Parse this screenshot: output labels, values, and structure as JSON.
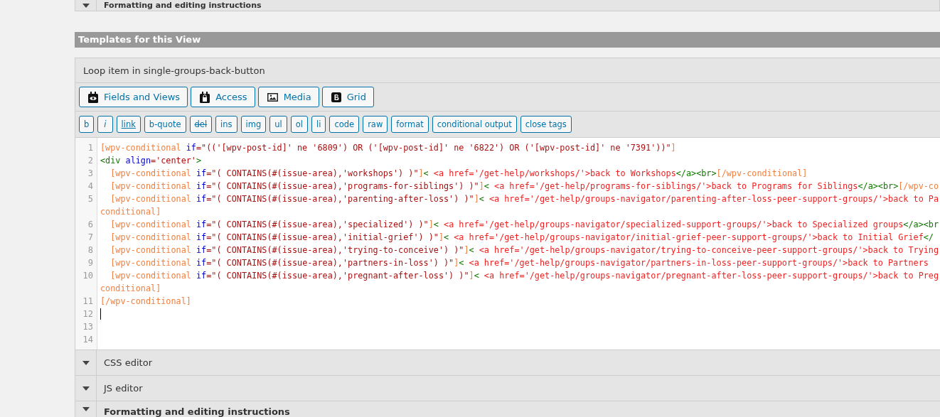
{
  "top_section": {
    "title": "Formatting and editing instructions"
  },
  "section_title": "Templates for this View",
  "template": {
    "title": "Loop item in single-groups-back-button",
    "toolbar": [
      {
        "label": "Fields and Views"
      },
      {
        "label": "Access"
      },
      {
        "label": "Media"
      },
      {
        "label": "Grid"
      }
    ],
    "quicktags": [
      {
        "label": "b",
        "kind": "plain"
      },
      {
        "label": "i",
        "kind": "italic"
      },
      {
        "label": "link",
        "kind": "underline"
      },
      {
        "label": "b-quote",
        "kind": "plain"
      },
      {
        "label": "del",
        "kind": "strike"
      },
      {
        "label": "ins",
        "kind": "plain"
      },
      {
        "label": "img",
        "kind": "plain"
      },
      {
        "label": "ul",
        "kind": "plain"
      },
      {
        "label": "ol",
        "kind": "plain"
      },
      {
        "label": "li",
        "kind": "plain"
      },
      {
        "label": "code",
        "kind": "plain"
      },
      {
        "label": "raw",
        "kind": "plain"
      },
      {
        "label": "format",
        "kind": "plain"
      },
      {
        "label": "conditional output",
        "kind": "plain"
      },
      {
        "label": "close tags",
        "kind": "plain"
      }
    ],
    "code_lines": [
      {
        "number": "1",
        "rows": [
          [
            {
              "kind": "shortcode",
              "text": "[wpv-conditional"
            },
            {
              "kind": "plain",
              "text": " "
            },
            {
              "kind": "keyword",
              "text": "if"
            },
            {
              "kind": "string",
              "text": "=\"(('[wpv-post-id]' ne '6809') OR ('[wpv-post-id]' ne '6822') OR ('[wpv-post-id]' ne '7391'))\""
            },
            {
              "kind": "shortcode",
              "text": "]"
            }
          ]
        ]
      },
      {
        "number": "2",
        "rows": [
          [
            {
              "kind": "tag",
              "text": "<div"
            },
            {
              "kind": "plain",
              "text": " "
            },
            {
              "kind": "keyword",
              "text": "align"
            },
            {
              "kind": "string",
              "text": "='center'"
            },
            {
              "kind": "tag",
              "text": ">"
            }
          ]
        ]
      },
      {
        "number": "3",
        "rows": [
          [
            {
              "kind": "plain",
              "text": "  "
            },
            {
              "kind": "shortcode",
              "text": "[wpv-conditional"
            },
            {
              "kind": "plain",
              "text": " "
            },
            {
              "kind": "keyword",
              "text": "if"
            },
            {
              "kind": "string",
              "text": "=\"( CONTAINS(#(issue-area),'workshops') )\""
            },
            {
              "kind": "shortcode",
              "text": "]"
            },
            {
              "kind": "tag",
              "text": "<"
            },
            {
              "kind": "error",
              "text": " <a href='/get-help/workshops/'>back to Workshops"
            },
            {
              "kind": "tag",
              "text": "</a><br>"
            },
            {
              "kind": "shortcode",
              "text": "[/wpv-conditional]"
            }
          ]
        ]
      },
      {
        "number": "4",
        "rows": [
          [
            {
              "kind": "plain",
              "text": "  "
            },
            {
              "kind": "shortcode",
              "text": "[wpv-conditional"
            },
            {
              "kind": "plain",
              "text": " "
            },
            {
              "kind": "keyword",
              "text": "if"
            },
            {
              "kind": "string",
              "text": "=\"( CONTAINS(#(issue-area),'programs-for-siblings') )\""
            },
            {
              "kind": "shortcode",
              "text": "]"
            },
            {
              "kind": "tag",
              "text": "<"
            },
            {
              "kind": "error",
              "text": " <a href='/get-help/programs-for-siblings/'>back to Programs for Siblings"
            },
            {
              "kind": "tag",
              "text": "</a><br>"
            },
            {
              "kind": "shortcode",
              "text": "[/wpv-co"
            }
          ]
        ]
      },
      {
        "number": "5",
        "rows": [
          [
            {
              "kind": "plain",
              "text": "  "
            },
            {
              "kind": "shortcode",
              "text": "[wpv-conditional"
            },
            {
              "kind": "plain",
              "text": " "
            },
            {
              "kind": "keyword",
              "text": "if"
            },
            {
              "kind": "string",
              "text": "=\"( CONTAINS(#(issue-area),'parenting-after-loss') )\""
            },
            {
              "kind": "shortcode",
              "text": "]"
            },
            {
              "kind": "tag",
              "text": "<"
            },
            {
              "kind": "error",
              "text": " <a href='/get-help/groups-navigator/parenting-after-loss-peer-support-groups/'>back to Pa"
            }
          ],
          [
            {
              "kind": "shortcode",
              "text": "conditional]"
            }
          ]
        ]
      },
      {
        "number": "6",
        "rows": [
          [
            {
              "kind": "plain",
              "text": "  "
            },
            {
              "kind": "shortcode",
              "text": "[wpv-conditional"
            },
            {
              "kind": "plain",
              "text": " "
            },
            {
              "kind": "keyword",
              "text": "if"
            },
            {
              "kind": "string",
              "text": "=\"( CONTAINS(#(issue-area),'specialized') )\""
            },
            {
              "kind": "shortcode",
              "text": "]"
            },
            {
              "kind": "tag",
              "text": "<"
            },
            {
              "kind": "error",
              "text": " <a href='/get-help/groups-navigator/specialized-support-groups/'>back to Specialized groups"
            },
            {
              "kind": "tag",
              "text": "</a><br"
            }
          ]
        ]
      },
      {
        "number": "7",
        "rows": [
          [
            {
              "kind": "plain",
              "text": "  "
            },
            {
              "kind": "shortcode",
              "text": "[wpv-conditional"
            },
            {
              "kind": "plain",
              "text": " "
            },
            {
              "kind": "keyword",
              "text": "if"
            },
            {
              "kind": "string",
              "text": "=\"( CONTAINS(#(issue-area),'initial-grief') )\""
            },
            {
              "kind": "shortcode",
              "text": "]"
            },
            {
              "kind": "tag",
              "text": "<"
            },
            {
              "kind": "error",
              "text": " <a href='/get-help/groups-navigator/initial-grief-peer-support-groups/'>back to Initial Grief"
            },
            {
              "kind": "tag",
              "text": "</"
            }
          ]
        ]
      },
      {
        "number": "8",
        "rows": [
          [
            {
              "kind": "plain",
              "text": "  "
            },
            {
              "kind": "shortcode",
              "text": "[wpv-conditional"
            },
            {
              "kind": "plain",
              "text": " "
            },
            {
              "kind": "keyword",
              "text": "if"
            },
            {
              "kind": "string",
              "text": "=\"( CONTAINS(#(issue-area),'trying-to-conceive') )\""
            },
            {
              "kind": "shortcode",
              "text": "]"
            },
            {
              "kind": "tag",
              "text": "<"
            },
            {
              "kind": "error",
              "text": " <a href='/get-help/groups-navigator/trying-to-conceive-peer-support-groups/'>back to Trying"
            }
          ]
        ]
      },
      {
        "number": "9",
        "rows": [
          [
            {
              "kind": "plain",
              "text": "  "
            },
            {
              "kind": "shortcode",
              "text": "[wpv-conditional"
            },
            {
              "kind": "plain",
              "text": " "
            },
            {
              "kind": "keyword",
              "text": "if"
            },
            {
              "kind": "string",
              "text": "=\"( CONTAINS(#(issue-area),'partners-in-loss') )\""
            },
            {
              "kind": "shortcode",
              "text": "]"
            },
            {
              "kind": "tag",
              "text": "<"
            },
            {
              "kind": "error",
              "text": " <a href='/get-help/groups-navigator/partners-in-loss-peer-support-groups/'>back to Partners"
            }
          ]
        ]
      },
      {
        "number": "10",
        "rows": [
          [
            {
              "kind": "plain",
              "text": "  "
            },
            {
              "kind": "shortcode",
              "text": "[wpv-conditional"
            },
            {
              "kind": "plain",
              "text": " "
            },
            {
              "kind": "keyword",
              "text": "if"
            },
            {
              "kind": "string",
              "text": "=\"( CONTAINS(#(issue-area),'pregnant-after-loss') )\""
            },
            {
              "kind": "shortcode",
              "text": "]"
            },
            {
              "kind": "tag",
              "text": "<"
            },
            {
              "kind": "error",
              "text": " <a href='/get-help/groups-navigator/pregnant-after-loss-peer-support-groups/'>back to Preg"
            }
          ],
          [
            {
              "kind": "shortcode",
              "text": "conditional]"
            }
          ]
        ]
      },
      {
        "number": "11",
        "rows": [
          [
            {
              "kind": "shortcode",
              "text": "[/wpv-conditional]"
            }
          ]
        ]
      },
      {
        "number": "12",
        "rows": [
          []
        ],
        "cursor": true
      },
      {
        "number": "13",
        "rows": [
          []
        ]
      },
      {
        "number": "14",
        "rows": [
          []
        ]
      }
    ]
  },
  "collapsed_sections": [
    {
      "title": "CSS editor",
      "bold": false
    },
    {
      "title": "JS editor",
      "bold": false
    },
    {
      "title": "Formatting and editing instructions",
      "bold": true
    }
  ]
}
